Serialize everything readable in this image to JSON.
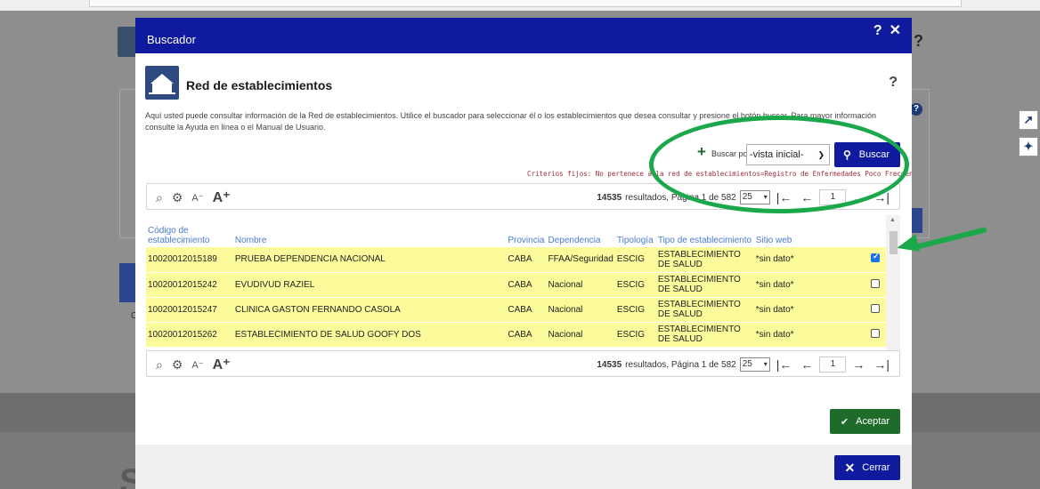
{
  "background": {
    "help_q1": "?",
    "help_q2": "?",
    "c_label": "C",
    "s_label": "S"
  },
  "modal": {
    "title": "Buscador",
    "help": "?",
    "close": "✕",
    "section_title": "Red de establecimientos",
    "section_help": "?",
    "description": "Aquí usted puede consultar información de la Red de establecimientos. Utilice el buscador para seleccionar él o los establecimientos que desea consultar y presione el botón buscar. Para mayor información consulte la Ayuda en línea o el Manual de Usuario.",
    "search": {
      "buscar_por_label": "Buscar por",
      "vista_value": "-vista inicial-",
      "buscar_button": "Buscar",
      "criterios": "Criterios fijos: No pertenece a la red de establecimientos=Registro de Enfermedades Poco Frecuentes (EPF"
    },
    "pagination": {
      "total": "14535",
      "text": "resultados, Página 1 de 582",
      "page_size": "25",
      "page_input": "1"
    },
    "table": {
      "headers": [
        "Código de establecimiento",
        "Nombre",
        "Provincia",
        "Dependencia",
        "Tipología",
        "Tipo de establecimiento",
        "Sitio web"
      ],
      "rows": [
        {
          "codigo": "10020012015189",
          "nombre": "PRUEBA DEPENDENCIA NACIONAL",
          "provincia": "CABA",
          "dependencia": "FFAA/Seguridad",
          "tipologia": "ESCIG",
          "tipo": "ESTABLECIMIENTO DE SALUD",
          "web": "*sin dato*",
          "checked": true
        },
        {
          "codigo": "10020012015242",
          "nombre": "EVUDIVUD RAZIEL",
          "provincia": "CABA",
          "dependencia": "Nacional",
          "tipologia": "ESCIG",
          "tipo": "ESTABLECIMIENTO DE SALUD",
          "web": "*sin dato*",
          "checked": false
        },
        {
          "codigo": "10020012015247",
          "nombre": "CLINICA GASTON FERNANDO CASOLA",
          "provincia": "CABA",
          "dependencia": "Nacional",
          "tipologia": "ESCIG",
          "tipo": "ESTABLECIMIENTO DE SALUD",
          "web": "*sin dato*",
          "checked": false
        },
        {
          "codigo": "10020012015262",
          "nombre": "ESTABLECIMIENTO DE SALUD GOOFY DOS",
          "provincia": "CABA",
          "dependencia": "Nacional",
          "tipologia": "ESCIG",
          "tipo": "ESTABLECIMIENTO DE SALUD",
          "web": "*sin dato*",
          "checked": false
        }
      ]
    },
    "aceptar": "Aceptar",
    "cerrar": "Cerrar"
  },
  "colors": {
    "header_blue": "#0f1a9e",
    "row_yellow": "#fbfb9c",
    "accept_green": "#1e6b2a",
    "annotation_green": "#1aa84a"
  }
}
